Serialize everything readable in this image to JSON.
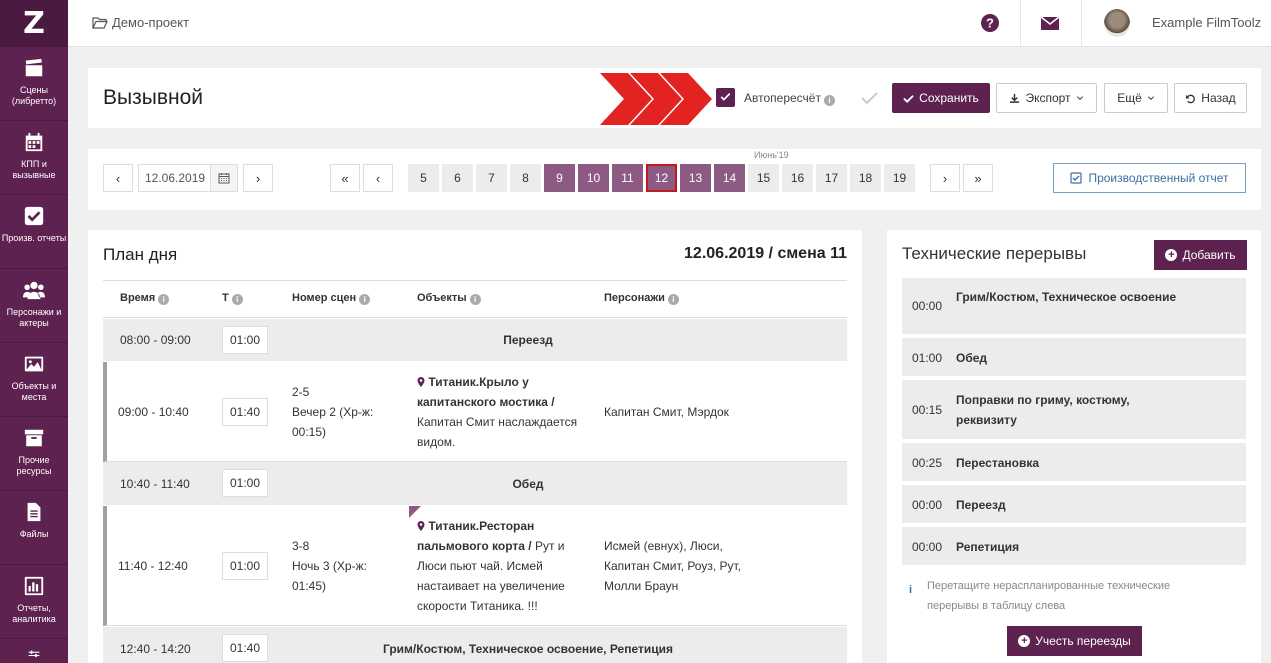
{
  "sidebar": {
    "logo": "Z",
    "items": [
      {
        "label": "Сцены (либретто)",
        "icon": "clapperboard-icon"
      },
      {
        "label": "КПП и вызывные",
        "icon": "calendar-icon"
      },
      {
        "label": "Произв. отчеты",
        "icon": "checkbox-icon"
      },
      {
        "label": "Персонажи и актеры",
        "icon": "users-icon"
      },
      {
        "label": "Объекты и места",
        "icon": "image-icon"
      },
      {
        "label": "Прочие ресурсы",
        "icon": "archive-icon"
      },
      {
        "label": "Файлы",
        "icon": "file-icon"
      },
      {
        "label": "Отчеты, аналитика",
        "icon": "bar-chart-icon"
      },
      {
        "label": "",
        "icon": "sliders-icon"
      }
    ]
  },
  "topbar": {
    "breadcrumb": "Демо-проект",
    "user_name": "Example FilmToolz"
  },
  "header": {
    "title": "Вызывной",
    "autorecalc_label": "Автопересчёт",
    "autorecalc_checked": true,
    "save_label": "Сохранить",
    "export_label": "Экспорт",
    "more_label": "Ещё",
    "back_label": "Назад"
  },
  "datenav": {
    "prev": "‹",
    "next": "›",
    "date": "12.06.2019",
    "first": "«",
    "prev_day": "‹",
    "next_day": "›",
    "last": "»",
    "month_label": "Июнь'19",
    "days": [
      "5",
      "6",
      "7",
      "8",
      "9",
      "10",
      "11",
      "12",
      "13",
      "14",
      "15",
      "16",
      "17",
      "18",
      "19"
    ],
    "selected_days": [
      "9",
      "10",
      "11",
      "12",
      "13",
      "14"
    ],
    "current_day": "12",
    "report_label": "Производственный отчет"
  },
  "plan": {
    "title": "План дня",
    "date_shift": "12.06.2019 / смена 11",
    "columns": [
      "Время",
      "Т",
      "Номер сцен",
      "Объекты",
      "Персонажи"
    ],
    "rows": [
      {
        "time": "08:00 - 09:00",
        "t": "01:00",
        "label": "Переезд"
      },
      {
        "time": "09:00 - 10:40",
        "t": "01:40",
        "scene_num": "2-5",
        "scene_desc": "Вечер 2 (Хр-ж: 00:15)",
        "object_bold": "Титаник.Крыло у капитанского мостика /",
        "object_text": "Капитан Смит наслаждается видом.",
        "characters": "Капитан Смит, Мэрдок"
      },
      {
        "time": "10:40 - 11:40",
        "t": "01:00",
        "label": "Обед"
      },
      {
        "time": "11:40 - 12:40",
        "t": "01:00",
        "scene_num": "3-8",
        "scene_desc": "Ночь 3 (Хр-ж: 01:45)",
        "object_bold": "Титаник.Ресторан пальмового корта /",
        "object_text": "Рут и Люси пьют чай. Исмей настаивает на увеличение скорости Титаника. !!!",
        "characters": "Исмей (евнух), Люси, Капитан Смит, Роуз, Рут, Молли Браун"
      },
      {
        "time": "12:40 - 14:20",
        "t": "01:40",
        "label": "Грим/Костюм, Техническое освоение, Репетиция"
      }
    ]
  },
  "tech": {
    "title": "Технические перерывы",
    "add_label": "Добавить",
    "items": [
      {
        "time": "00:00",
        "name": "Грим/Костюм, Техническое освоение"
      },
      {
        "time": "01:00",
        "name": "Обед"
      },
      {
        "time": "00:15",
        "name": "Поправки по гриму, костюму, реквизиту"
      },
      {
        "time": "00:25",
        "name": "Перестановка"
      },
      {
        "time": "00:00",
        "name": "Переезд"
      },
      {
        "time": "00:00",
        "name": "Репетиция"
      }
    ],
    "hint": "Перетащите нераспланированные технические перерывы в таблицу слева",
    "moves_label": "Учесть переезды"
  },
  "colors": {
    "brand": "#5e2250",
    "day_selected": "#8c5a82",
    "current_outline": "#c21a1a",
    "chevrons": "#e32222"
  }
}
